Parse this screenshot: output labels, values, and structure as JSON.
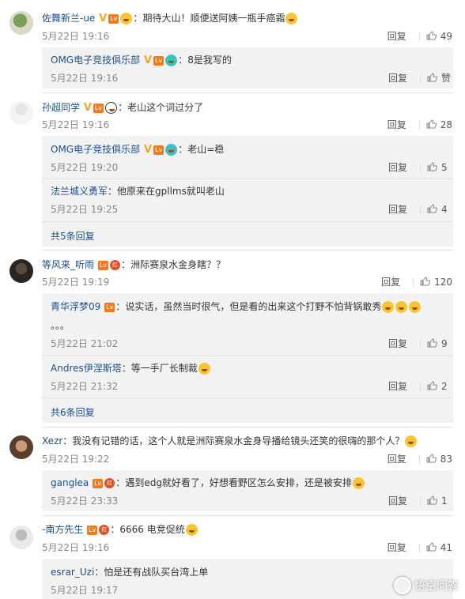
{
  "labels": {
    "reply": "回复",
    "like": "赞",
    "colon": "："
  },
  "comments": [
    {
      "name": "佐舞新兰-ue",
      "text": "期待大山！顺便送阿姨一瓶手癌霜",
      "date": "5月22日 19:16",
      "likes": "49",
      "replies": [
        {
          "name": "OMG电子竞技俱乐部",
          "text": "8是我写的",
          "date": "5月22日 19:16",
          "likes": "赞"
        }
      ]
    },
    {
      "name": "孙超同学",
      "text": "老山这个词过分了",
      "date": "5月22日 19:16",
      "likes": "28",
      "replies": [
        {
          "name": "OMG电子竞技俱乐部",
          "text": "老山=稳",
          "date": "5月22日 19:20",
          "likes": "5"
        },
        {
          "name": "法兰城义勇军",
          "text": "他原来在gpllms就叫老山",
          "date": "5月22日 19:25",
          "likes": "4"
        }
      ],
      "more": "共5条回复"
    },
    {
      "name": "等风来_听雨",
      "text": "洲际赛泉水金身瞎？？",
      "date": "5月22日 19:19",
      "likes": "120",
      "replies": [
        {
          "name": "青华浮梦09",
          "text": "说实话，虽然当时很气，但是看的出来这个打野不怕背锅敢秀",
          "text2": "。。。",
          "date": "5月22日 21:02",
          "likes": "9"
        },
        {
          "name": "Andres伊涅斯塔",
          "text": "等一手厂长制裁",
          "date": "5月22日 21:32",
          "likes": "2"
        }
      ],
      "more": "共6条回复"
    },
    {
      "name": "Xezr",
      "text": "我没有记错的话，这个人就是洲际赛泉水金身导播给镜头还笑的很嗨的那个人？",
      "date": "5月22日 19:22",
      "likes": "83",
      "replies": [
        {
          "name": "ganglea",
          "text": "遇到edg就好看了，好想看野区怎么安排，还是被安排",
          "date": "5月22日 23:33",
          "likes": "1"
        }
      ]
    },
    {
      "name": "-南方先生",
      "text": "6666 电竞促统",
      "date": "5月22日 19:16",
      "likes": "41",
      "replies": [
        {
          "name": "esrar_Uzi",
          "text": "怕是还有战队买台湾上单",
          "date": "5月22日 19:17",
          "likes": ""
        }
      ]
    }
  ],
  "badges": {
    "lv": "Lv",
    "hong": "红"
  },
  "watermark": "悟空问答"
}
